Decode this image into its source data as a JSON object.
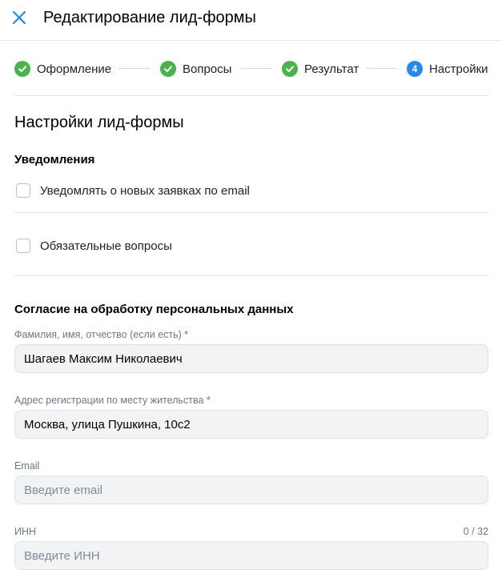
{
  "header": {
    "title": "Редактирование лид-формы",
    "close_icon": "close-icon"
  },
  "steps": [
    {
      "label": "Оформление",
      "state": "done",
      "icon": "check-icon"
    },
    {
      "label": "Вопросы",
      "state": "done",
      "icon": "check-icon"
    },
    {
      "label": "Результат",
      "state": "done",
      "icon": "check-icon"
    },
    {
      "label": "Настройки",
      "state": "current",
      "number": "4"
    }
  ],
  "colors": {
    "accent": "#2688eb",
    "done": "#4bb34b",
    "required": "#e64646"
  },
  "settings": {
    "title": "Настройки лид-формы",
    "notifications_heading": "Уведомления",
    "notify_email_label": "Уведомлять о новых заявках по email",
    "notify_email_checked": false,
    "required_questions_label": "Обязательные вопросы",
    "required_questions_checked": false
  },
  "consent": {
    "heading": "Согласие на обработку персональных данных",
    "fields": [
      {
        "label": "Фамилия, имя, отчество (если есть)",
        "required_mark": "*",
        "value": "Шагаев Максим Николаевич",
        "placeholder": ""
      },
      {
        "label": "Адрес регистрации по месту жительства",
        "required_mark": "*",
        "value": "Москва, улица Пушкина, 10с2",
        "placeholder": ""
      },
      {
        "label": "Email",
        "value": "",
        "placeholder": "Введите email"
      },
      {
        "label": "ИНН",
        "value": "",
        "placeholder": "Введите ИНН",
        "counter": "0 / 32"
      }
    ]
  }
}
